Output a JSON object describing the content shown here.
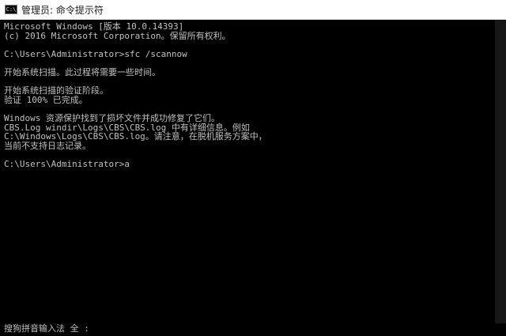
{
  "window": {
    "title": "管理员: 命令提示符",
    "icon_label": "C:\\",
    "icon": "terminal-icon"
  },
  "console": {
    "lines": [
      "Microsoft Windows [版本 10.0.14393]",
      "(c) 2016 Microsoft Corporation。保留所有权利。",
      "",
      "C:\\Users\\Administrator>sfc /scannow",
      "",
      "开始系统扫描。此过程将需要一些时间。",
      "",
      "开始系统扫描的验证阶段。",
      "验证 100% 已完成。",
      "",
      "Windows 资源保护找到了损坏文件并成功修复了它们。",
      "CBS.Log windir\\Logs\\CBS\\CBS.log 中有详细信息。例如",
      "C:\\Windows\\Logs\\CBS\\CBS.log。请注意，在脱机服务方案中，",
      "当前不支持日志记录。",
      "",
      "C:\\Users\\Administrator>a"
    ]
  },
  "ime": {
    "status": "搜狗拼音输入法 全 :"
  },
  "colors": {
    "console_bg": "#000000",
    "console_text": "#c0c0c0",
    "titlebar_bg": "#ffffff"
  }
}
